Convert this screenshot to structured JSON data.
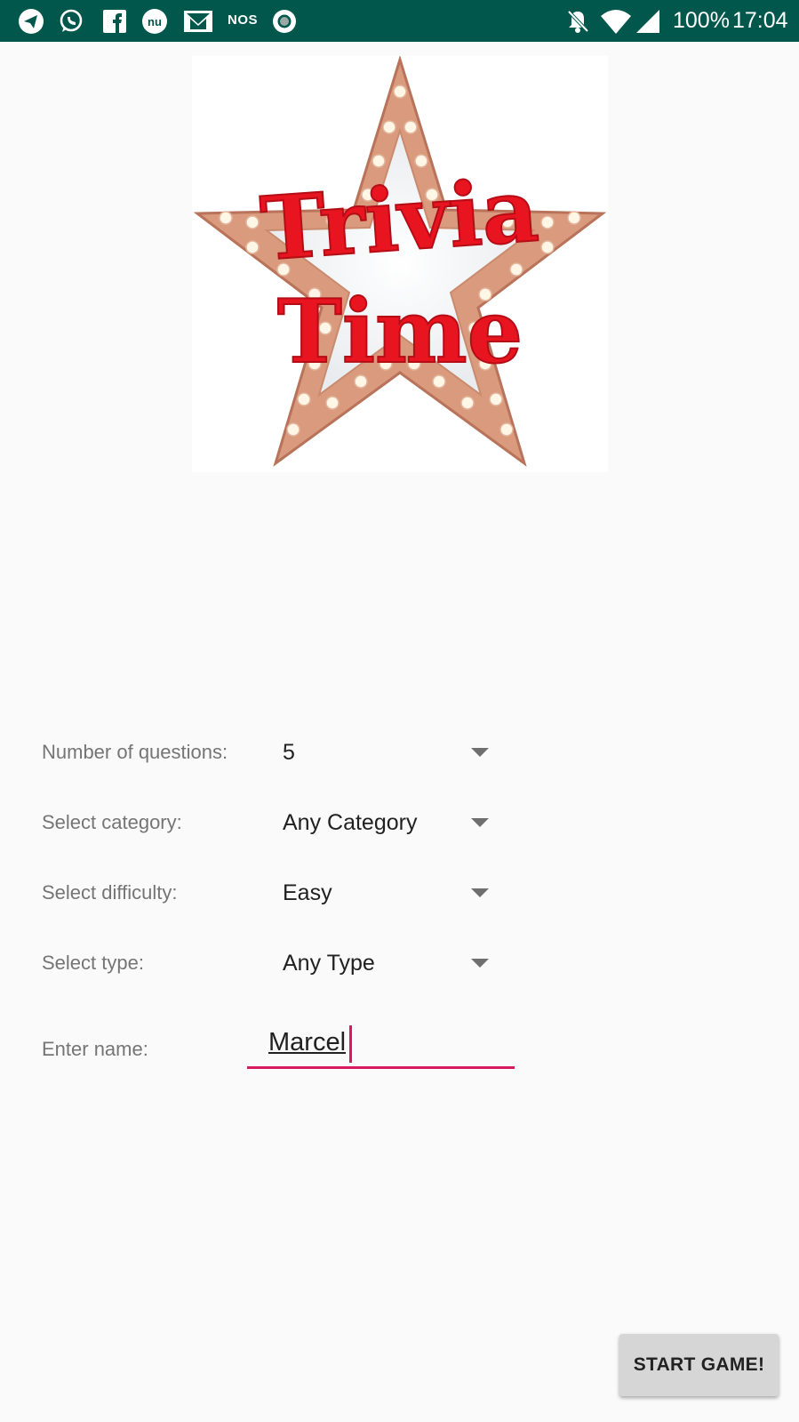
{
  "status_bar": {
    "notification_icons": [
      "telegram-icon",
      "whatsapp-icon",
      "facebook-icon",
      "nu-icon",
      "gmail-icon",
      "nos-icon",
      "record-icon"
    ],
    "nos_label": "NOS",
    "battery": "100%",
    "time": "17:04",
    "system_icons": [
      "notifications-off-icon",
      "wifi-icon",
      "signal-icon"
    ]
  },
  "logo": {
    "line1": "Trivia",
    "line2": "Time",
    "text_color": "#e8141f",
    "star_color": "#d99a7e"
  },
  "form": {
    "questions": {
      "label": "Number of questions:",
      "value": "5"
    },
    "category": {
      "label": "Select category:",
      "value": "Any Category"
    },
    "difficulty": {
      "label": "Select difficulty:",
      "value": "Easy"
    },
    "type": {
      "label": "Select type:",
      "value": "Any Type"
    },
    "name": {
      "label": "Enter name:",
      "value": "Marcel"
    }
  },
  "start_button": {
    "label": "START GAME!"
  },
  "colors": {
    "status_bar": "#01574b",
    "accent": "#d81b60",
    "background": "#fafafa"
  }
}
